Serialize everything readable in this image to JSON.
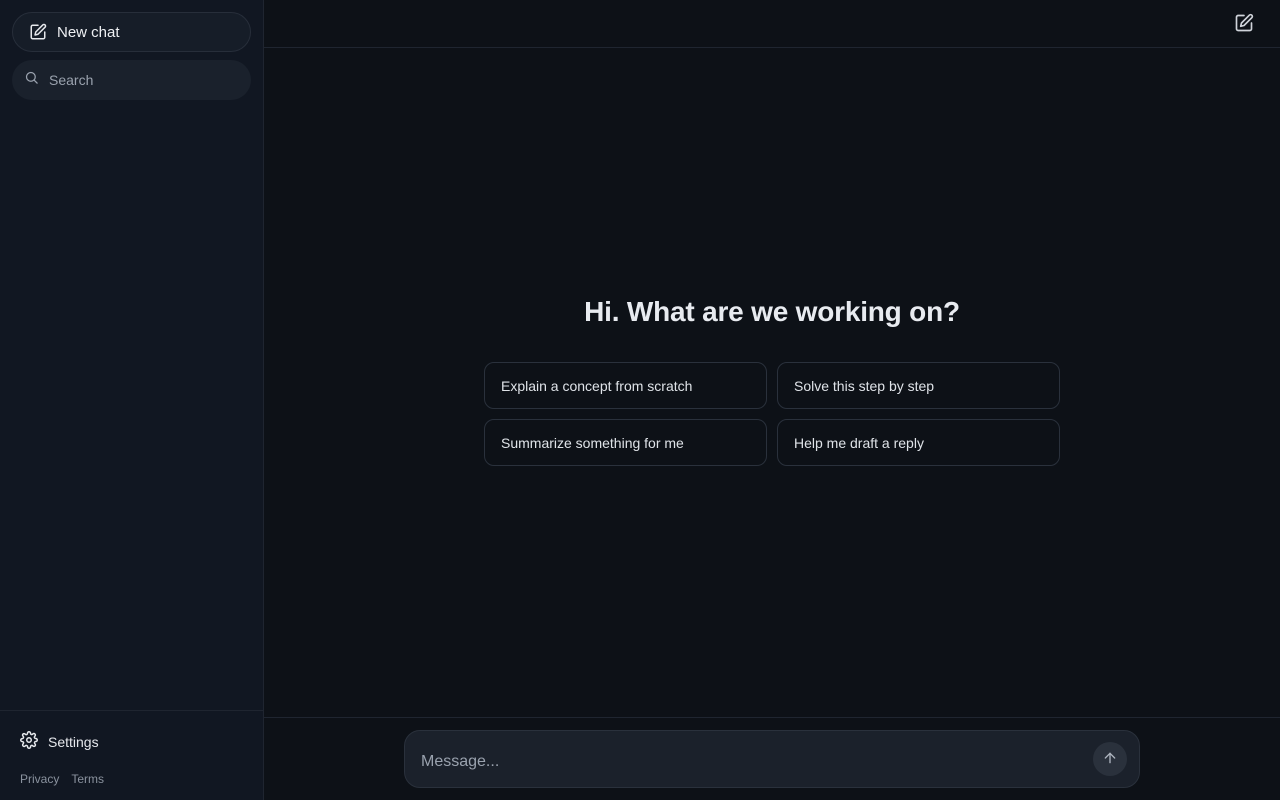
{
  "sidebar": {
    "new_chat_label": "New chat",
    "search_placeholder": "Search",
    "settings_label": "Settings",
    "privacy_label": "Privacy",
    "terms_label": "Terms"
  },
  "main": {
    "greeting": "Hi. What are we working on?",
    "suggestions": [
      "Explain a concept from scratch",
      "Solve this step by step",
      "Summarize something for me",
      "Help me draft a reply"
    ]
  },
  "composer": {
    "placeholder": "Message..."
  },
  "icons": {
    "new_chat": "compose-icon",
    "search": "search-icon",
    "settings": "gear-icon",
    "topbar_compose": "compose-icon",
    "send": "arrow-up-icon"
  },
  "colors": {
    "background": "#0d1117",
    "sidebar": "#111722",
    "border": "#1f2530",
    "input": "#1b212b"
  }
}
